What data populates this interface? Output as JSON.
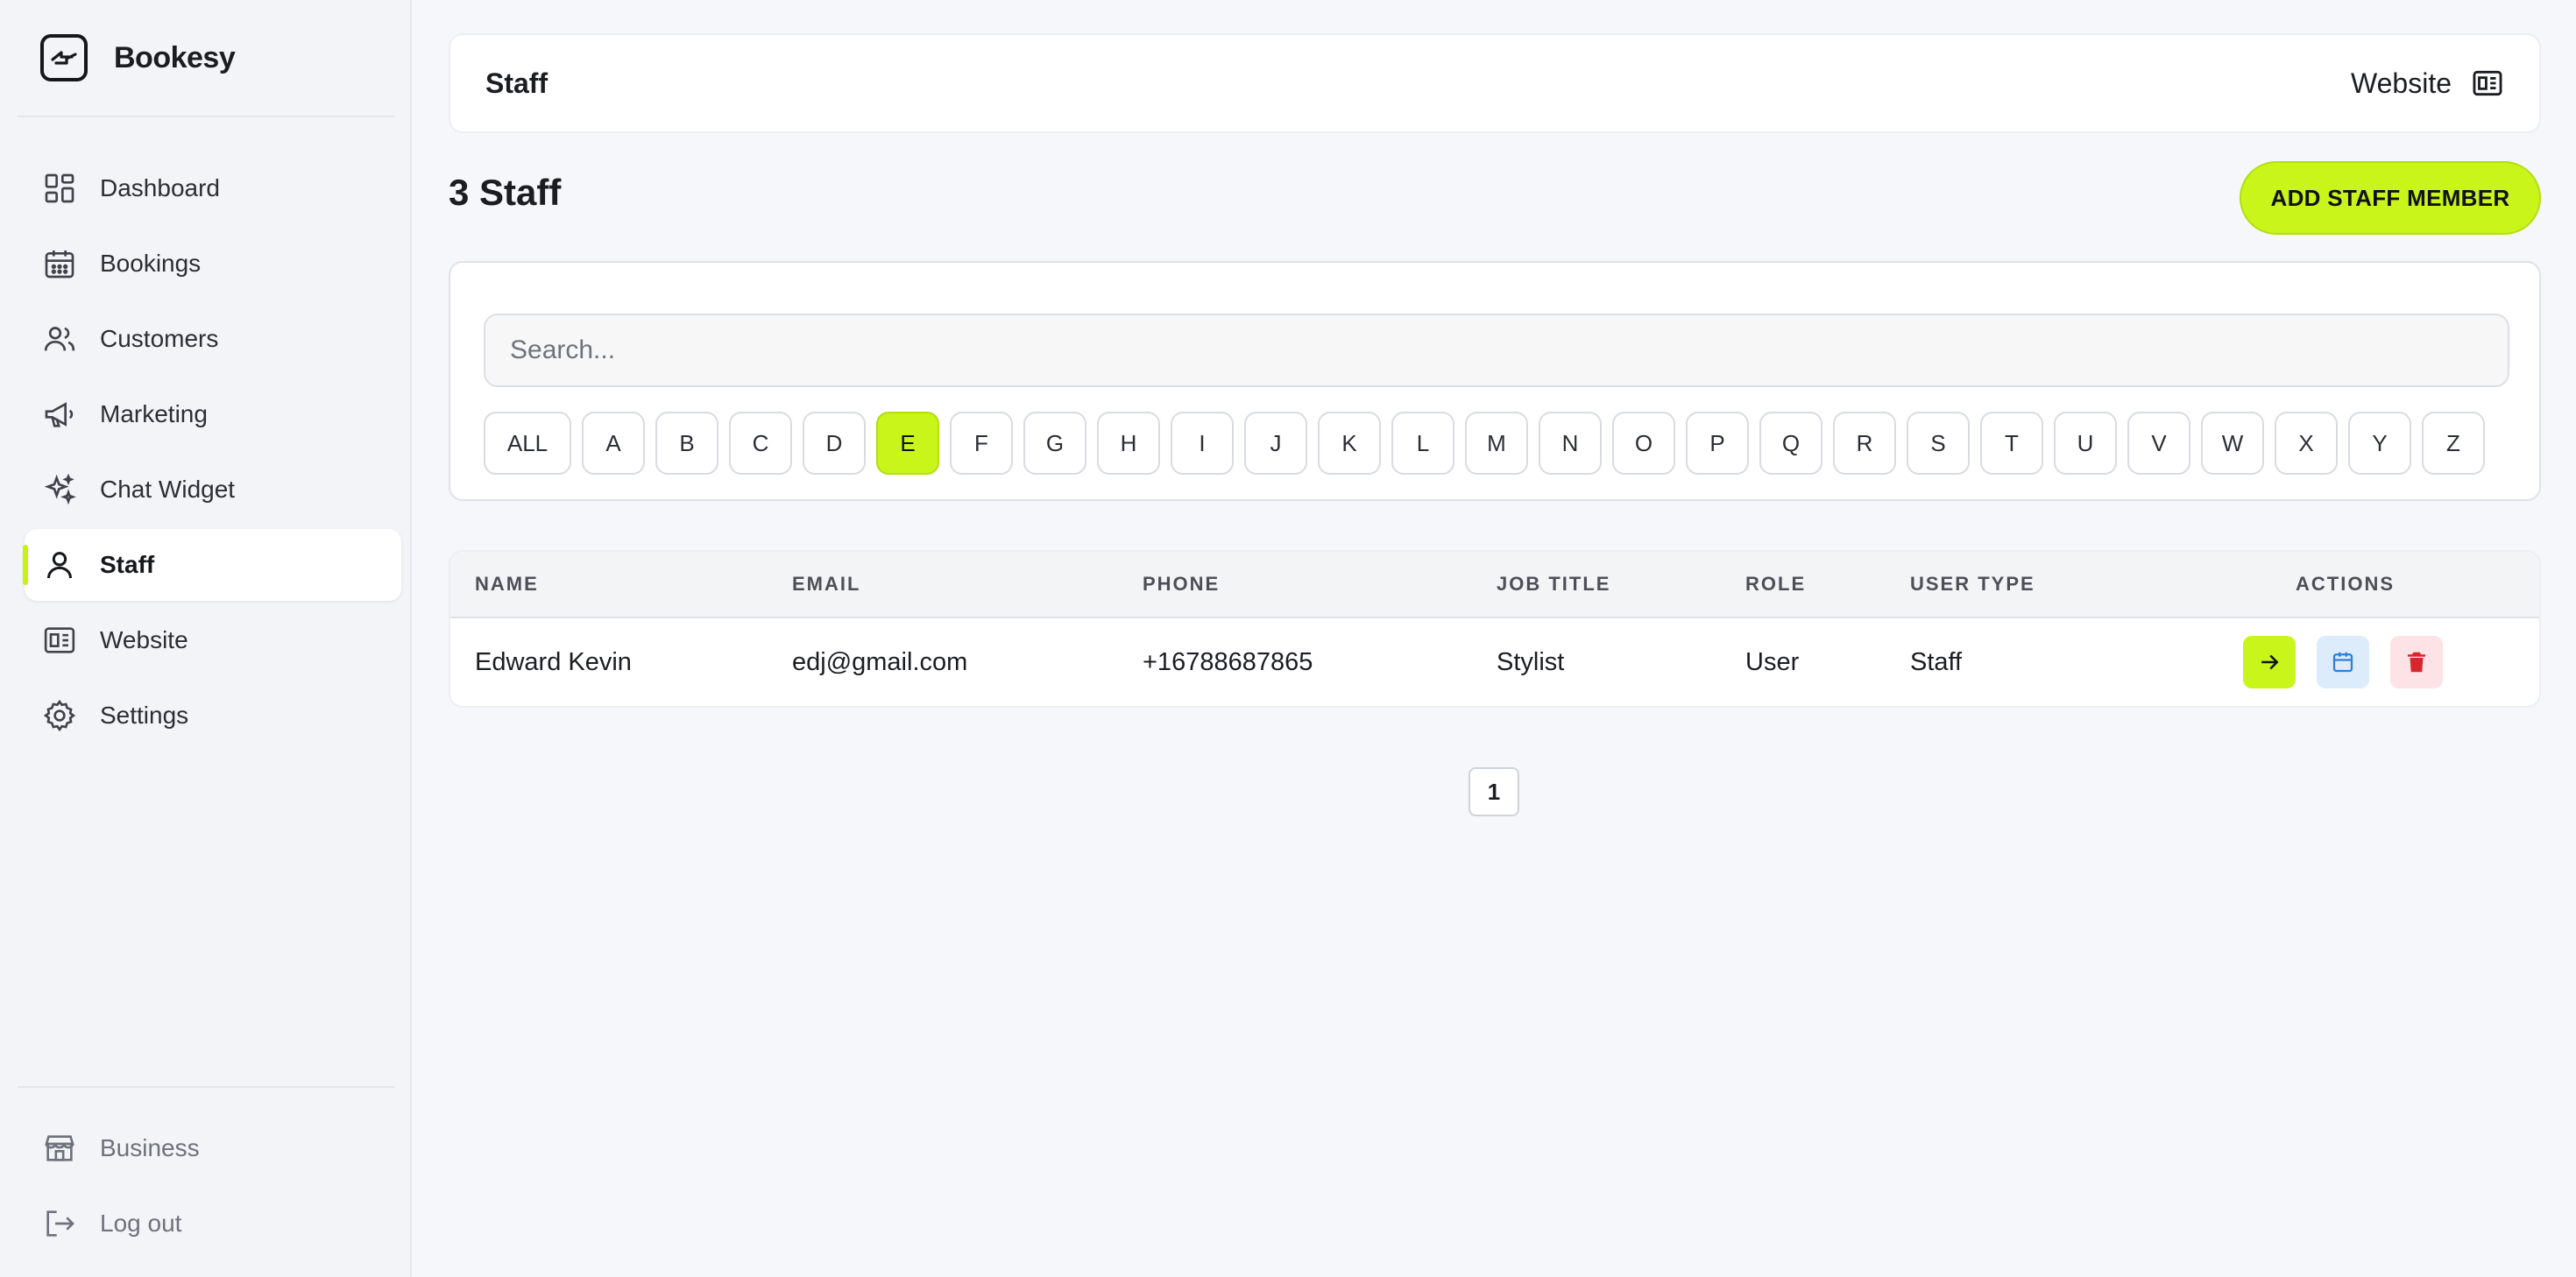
{
  "brand": {
    "name": "Bookesy"
  },
  "sidebar": {
    "items": [
      {
        "label": "Dashboard",
        "icon": "dashboard-icon"
      },
      {
        "label": "Bookings",
        "icon": "calendar-icon"
      },
      {
        "label": "Customers",
        "icon": "users-icon"
      },
      {
        "label": "Marketing",
        "icon": "megaphone-icon"
      },
      {
        "label": "Chat Widget",
        "icon": "sparkles-icon"
      },
      {
        "label": "Staff",
        "icon": "user-icon",
        "active": true
      },
      {
        "label": "Website",
        "icon": "website-icon"
      },
      {
        "label": "Settings",
        "icon": "gear-icon"
      }
    ],
    "footer": [
      {
        "label": "Business",
        "icon": "storefront-icon"
      },
      {
        "label": "Log out",
        "icon": "logout-icon"
      }
    ]
  },
  "topbar": {
    "title": "Staff",
    "website_label": "Website"
  },
  "page": {
    "heading": "3 Staff",
    "add_button": "ADD STAFF MEMBER"
  },
  "filter": {
    "search_placeholder": "Search...",
    "letters": [
      "ALL",
      "A",
      "B",
      "C",
      "D",
      "E",
      "F",
      "G",
      "H",
      "I",
      "J",
      "K",
      "L",
      "M",
      "N",
      "O",
      "P",
      "Q",
      "R",
      "S",
      "T",
      "U",
      "V",
      "W",
      "X",
      "Y",
      "Z"
    ],
    "selected_letter": "E"
  },
  "table": {
    "columns": [
      "NAME",
      "EMAIL",
      "PHONE",
      "JOB TITLE",
      "ROLE",
      "USER TYPE",
      "ACTIONS"
    ],
    "rows": [
      {
        "name": "Edward Kevin",
        "email": "edj@gmail.com",
        "phone": "+16788687865",
        "job_title": "Stylist",
        "role": "User",
        "user_type": "Staff"
      }
    ]
  },
  "pagination": {
    "current": "1"
  },
  "colors": {
    "accent": "#c9f51b",
    "danger": "#d7262e",
    "info": "#2f7fd6"
  }
}
